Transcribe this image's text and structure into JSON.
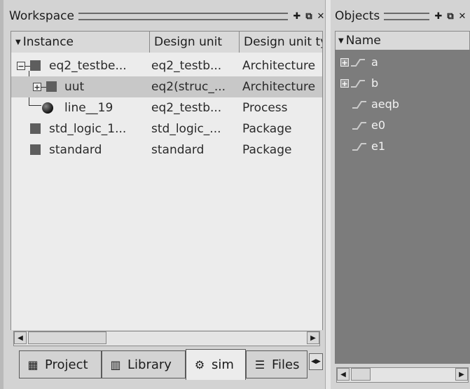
{
  "workspace": {
    "title": "Workspace",
    "columns": [
      "Instance",
      "Design unit",
      "Design unit ty"
    ],
    "rows": [
      {
        "expander": "−",
        "instance": "eq2_testbe...",
        "design_unit": "eq2_testb...",
        "type": "Architecture"
      },
      {
        "expander": "+",
        "instance": "uut",
        "design_unit": "eq2(struc_...",
        "type": "Architecture"
      },
      {
        "expander": "",
        "instance": "line__19",
        "design_unit": "eq2_testb...",
        "type": "Process"
      },
      {
        "expander": "",
        "instance": "std_logic_1...",
        "design_unit": "std_logic_...",
        "type": "Package"
      },
      {
        "expander": "",
        "instance": "standard",
        "design_unit": "standard",
        "type": "Package"
      }
    ],
    "tabs": [
      {
        "label": "Project",
        "icon": "project-icon"
      },
      {
        "label": "Library",
        "icon": "library-icon"
      },
      {
        "label": "sim",
        "icon": "sim-icon"
      },
      {
        "label": "Files",
        "icon": "files-icon"
      }
    ],
    "active_tab": "sim"
  },
  "objects": {
    "title": "Objects",
    "column": "Name",
    "items": [
      {
        "expander": "+",
        "name": "a"
      },
      {
        "expander": "+",
        "name": "b"
      },
      {
        "expander": "",
        "name": "aeqb"
      },
      {
        "expander": "",
        "name": "e0"
      },
      {
        "expander": "",
        "name": "e1"
      }
    ]
  },
  "titlebar_icons": [
    "dock-icon",
    "undock-icon",
    "close-icon"
  ],
  "colors": {
    "objects_bg": "#7c7c7c",
    "selected_row": "#c8c8c8",
    "panel": "#d3d3d3"
  }
}
